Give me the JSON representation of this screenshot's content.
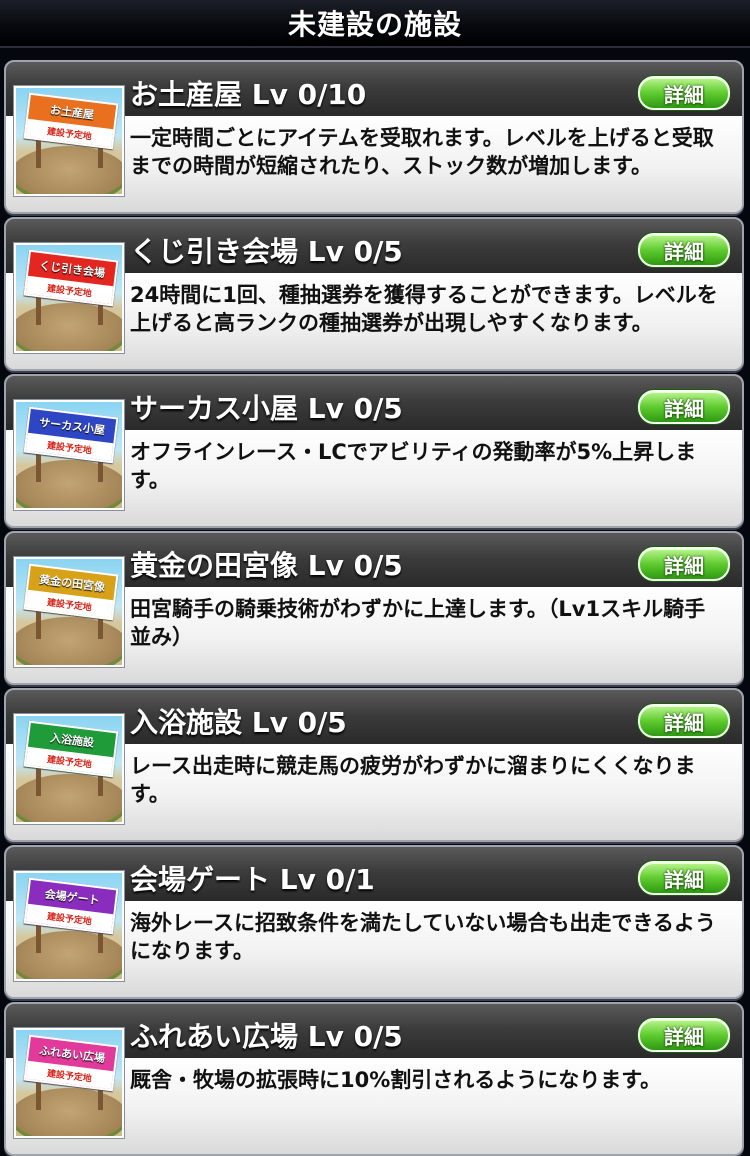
{
  "header": {
    "title": "未建設の施設"
  },
  "common": {
    "detail_label": "詳細",
    "plan_label": "建設予定地"
  },
  "facilities": [
    {
      "name": "お土産屋 Lv 0/10",
      "sign": "お土産屋",
      "sign_color": "#e8701e",
      "desc": "一定時間ごとにアイテムを受取れます。レベルを上げると受取までの時間が短縮されたり、ストック数が増加します。"
    },
    {
      "name": "くじ引き会場 Lv 0/5",
      "sign": "くじ引き会場",
      "sign_color": "#e3261f",
      "desc": "24時間に1回、種抽選券を獲得することができます。レベルを上げると高ランクの種抽選券が出現しやすくなります。"
    },
    {
      "name": "サーカス小屋 Lv 0/5",
      "sign": "サーカス小屋",
      "sign_color": "#2f46c4",
      "desc": "オフラインレース・LCでアビリティの発動率が5%上昇します。"
    },
    {
      "name": "黄金の田宮像 Lv 0/5",
      "sign": "黄金の田宮像",
      "sign_color": "#d7a21a",
      "desc": "田宮騎手の騎乗技術がわずかに上達します。（Lv1スキル騎手並み）"
    },
    {
      "name": "入浴施設 Lv 0/5",
      "sign": "入浴施設",
      "sign_color": "#1f9b3a",
      "desc": "レース出走時に競走馬の疲労がわずかに溜まりにくくなります。"
    },
    {
      "name": "会場ゲート Lv 0/1",
      "sign": "会場ゲート",
      "sign_color": "#8a2dbf",
      "desc": "海外レースに招致条件を満たしていない場合も出走できるようになります。"
    },
    {
      "name": "ふれあい広場 Lv 0/5",
      "sign": "ふれあい広場",
      "sign_color": "#e23a9a",
      "desc": "厩舎・牧場の拡張時に10%割引されるようになります。"
    }
  ]
}
